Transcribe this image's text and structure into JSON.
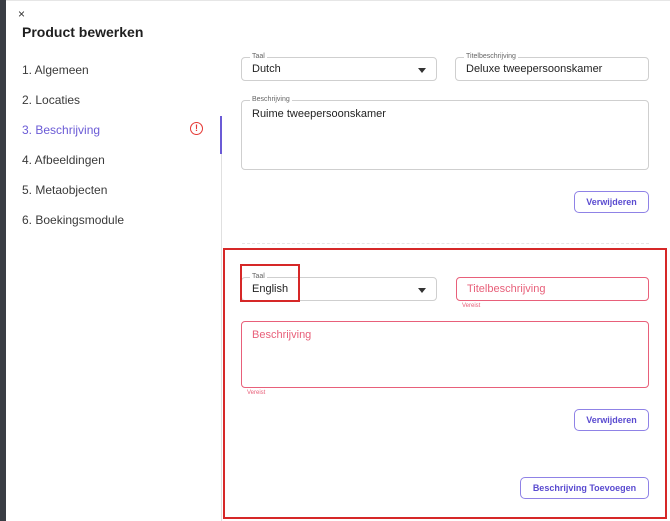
{
  "header": {
    "close_symbol": "×",
    "title": "Product bewerken"
  },
  "sidebar": {
    "items": [
      {
        "label": "1. Algemeen"
      },
      {
        "label": "2. Locaties"
      },
      {
        "label": "3. Beschrijving",
        "active": true,
        "warning": true
      },
      {
        "label": "4. Afbeeldingen"
      },
      {
        "label": "5. Metaobjecten"
      },
      {
        "label": "6. Boekingsmodule"
      }
    ]
  },
  "warning_symbol": "!",
  "descriptions": [
    {
      "language_label": "Taal",
      "language_value": "Dutch",
      "title_label": "Titelbeschrijving",
      "title_value": "Deluxe tweepersoonskamer",
      "description_label": "Beschrijving",
      "description_value": "Ruime tweepersoonskamer",
      "remove_label": "Verwijderen"
    },
    {
      "language_label": "Taal",
      "language_value": "English",
      "title_placeholder": "Titelbeschrijving",
      "title_helper": "Vereist",
      "description_placeholder": "Beschrijving",
      "description_helper": "Vereist",
      "remove_label": "Verwijderen"
    }
  ],
  "add_button_label": "Beschrijving Toevoegen",
  "colors": {
    "accent": "#6b5bd6",
    "error": "#e8607a",
    "highlight": "#d62828"
  }
}
